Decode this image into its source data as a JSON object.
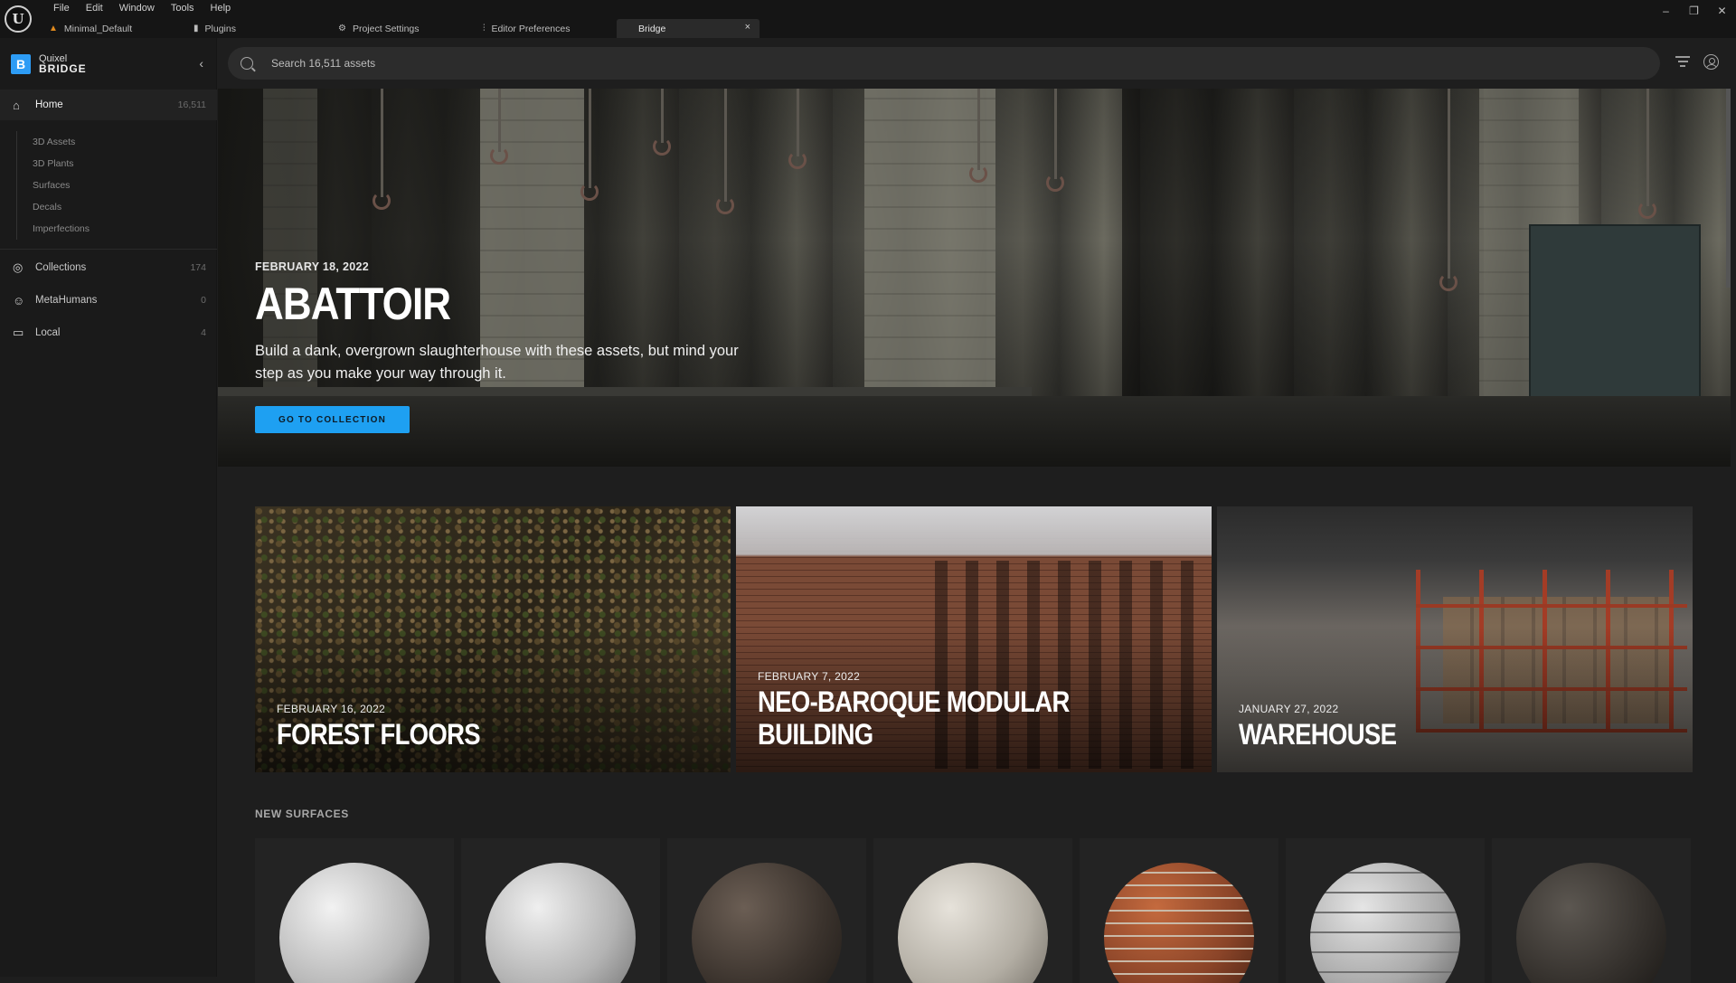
{
  "menu": [
    "File",
    "Edit",
    "Window",
    "Tools",
    "Help"
  ],
  "tabs": [
    {
      "label": "Minimal_Default",
      "icon": "level-icon"
    },
    {
      "label": "Plugins",
      "icon": "plug-icon"
    },
    {
      "label": "Project Settings",
      "icon": "gear-icon"
    },
    {
      "label": "Editor Preferences",
      "icon": "sliders-icon"
    },
    {
      "label": "Bridge",
      "icon": "close-icon"
    }
  ],
  "window_controls": [
    "–",
    "❐",
    "✕"
  ],
  "brand": {
    "line1": "Quixel",
    "line2": "BRIDGE"
  },
  "sidebar": {
    "home": {
      "label": "Home",
      "count": "16,511"
    },
    "sub_items": [
      "3D Assets",
      "3D Plants",
      "Surfaces",
      "Decals",
      "Imperfections"
    ],
    "items": [
      {
        "label": "Collections",
        "count": "174"
      },
      {
        "label": "MetaHumans",
        "count": "0"
      },
      {
        "label": "Local",
        "count": "4"
      }
    ]
  },
  "search": {
    "placeholder": "Search 16,511 assets"
  },
  "hero": {
    "date": "FEBRUARY 18, 2022",
    "title": "ABATTOIR",
    "description": "Build a dank, overgrown slaughterhouse with these assets, but mind your step as you make your way through it.",
    "button": "GO TO COLLECTION"
  },
  "features": [
    {
      "date": "FEBRUARY 16, 2022",
      "title": "FOREST FLOORS"
    },
    {
      "date": "FEBRUARY 7, 2022",
      "title": "NEO-BAROQUE MODULAR BUILDING"
    },
    {
      "date": "JANUARY 27, 2022",
      "title": "WAREHOUSE"
    }
  ],
  "new_surfaces": {
    "title": "NEW SURFACES",
    "count": 7
  },
  "colors": {
    "accent": "#1ea0f2",
    "brand": "#2d9cf5",
    "background": "#1e1e1e",
    "sidebar": "#1a1a1a"
  }
}
